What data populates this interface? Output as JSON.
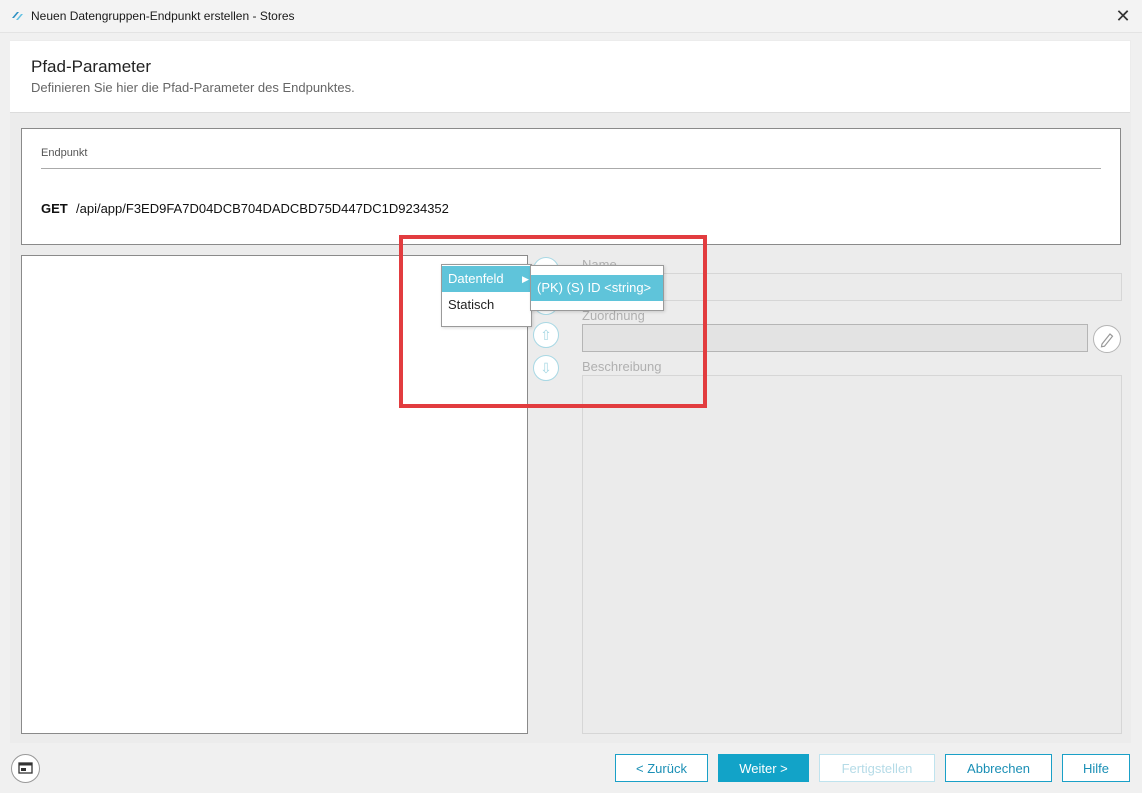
{
  "window": {
    "title": "Neuen Datengruppen-Endpunkt erstellen - Stores",
    "close_label": "✕"
  },
  "header": {
    "title": "Pfad-Parameter",
    "subtitle": "Definieren Sie hier die Pfad-Parameter des Endpunktes."
  },
  "endpoint": {
    "label": "Endpunkt",
    "method": "GET",
    "path": "/api/app/F3ED9FA7D04DCB704DADCBD75D447DC1D9234352"
  },
  "side_buttons": [
    {
      "icon": "add-icon",
      "glyph": "+"
    },
    {
      "icon": "remove-icon",
      "glyph": "−"
    },
    {
      "icon": "arrow-up-icon",
      "glyph": "⇧"
    },
    {
      "icon": "arrow-down-icon",
      "glyph": "⇩"
    }
  ],
  "details": {
    "name_label": "Name",
    "zuordnung_label": "Zuordnung",
    "beschreibung_label": "Beschreibung"
  },
  "context_menu": {
    "items": [
      {
        "label": "Datenfeld",
        "has_submenu": true,
        "selected": true
      },
      {
        "label": "Statisch"
      }
    ],
    "submenu": [
      {
        "label": "(PK) (S) ID <string>",
        "selected": true
      }
    ]
  },
  "footer": {
    "back": "< Zurück",
    "next": "Weiter >",
    "finish": "Fertigstellen",
    "cancel": "Abbrechen",
    "help": "Hilfe"
  },
  "colors": {
    "accent": "#12a3c8",
    "menu_highlight": "#5fc4da",
    "highlight_box": "#e23c3f"
  }
}
